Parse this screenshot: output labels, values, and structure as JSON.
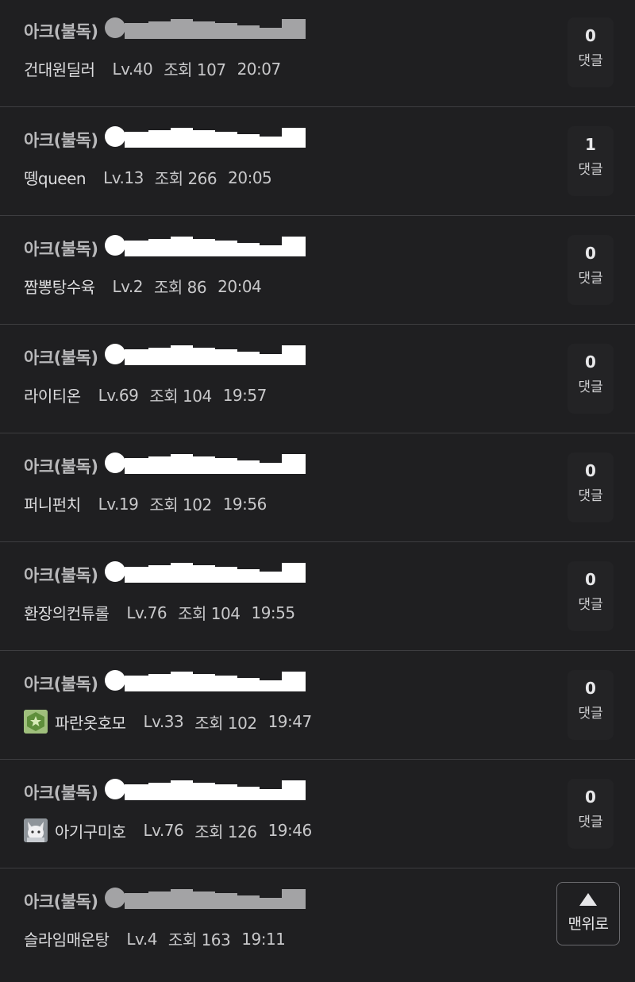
{
  "posts": [
    {
      "board": "아크(불독)",
      "author": "건대원딜러",
      "level": "Lv.40",
      "views": "조회 107",
      "time": "20:07",
      "comment_count": "0",
      "comment_label": "댓글",
      "avatar": "",
      "redaction_color": "#a3a3a5"
    },
    {
      "board": "아크(불독)",
      "author": "뗑queen",
      "level": "Lv.13",
      "views": "조회 266",
      "time": "20:05",
      "comment_count": "1",
      "comment_label": "댓글",
      "avatar": "",
      "redaction_color": "#ffffff"
    },
    {
      "board": "아크(불독)",
      "author": "짬뽕탕수육",
      "level": "Lv.2",
      "views": "조회 86",
      "time": "20:04",
      "comment_count": "0",
      "comment_label": "댓글",
      "avatar": "",
      "redaction_color": "#ffffff"
    },
    {
      "board": "아크(불독)",
      "author": "라이티온",
      "level": "Lv.69",
      "views": "조회 104",
      "time": "19:57",
      "comment_count": "0",
      "comment_label": "댓글",
      "avatar": "",
      "redaction_color": "#ffffff"
    },
    {
      "board": "아크(불독)",
      "author": "퍼니펀치",
      "level": "Lv.19",
      "views": "조회 102",
      "time": "19:56",
      "comment_count": "0",
      "comment_label": "댓글",
      "avatar": "",
      "redaction_color": "#ffffff"
    },
    {
      "board": "아크(불독)",
      "author": "환장의컨튜롤",
      "level": "Lv.76",
      "views": "조회 104",
      "time": "19:55",
      "comment_count": "0",
      "comment_label": "댓글",
      "avatar": "",
      "redaction_color": "#ffffff"
    },
    {
      "board": "아크(불독)",
      "author": "파란옷호모",
      "level": "Lv.33",
      "views": "조회 102",
      "time": "19:47",
      "comment_count": "0",
      "comment_label": "댓글",
      "avatar": "green-badge-icon",
      "redaction_color": "#ffffff"
    },
    {
      "board": "아크(불독)",
      "author": "아기구미호",
      "level": "Lv.76",
      "views": "조회 126",
      "time": "19:46",
      "comment_count": "0",
      "comment_label": "댓글",
      "avatar": "fox-avatar-icon",
      "redaction_color": "#ffffff"
    },
    {
      "board": "아크(불독)",
      "author": "슬라임매운탕",
      "level": "Lv.4",
      "views": "조회 163",
      "time": "19:11",
      "comment_count": "",
      "comment_label": "",
      "avatar": "",
      "redaction_color": "#a3a3a5"
    }
  ],
  "scroll_top": {
    "label": "맨위로",
    "icon": "up-arrow-icon"
  },
  "colors": {
    "background": "#1f1f21",
    "divider": "#3d3d40",
    "board_text": "#b9b9bb"
  }
}
